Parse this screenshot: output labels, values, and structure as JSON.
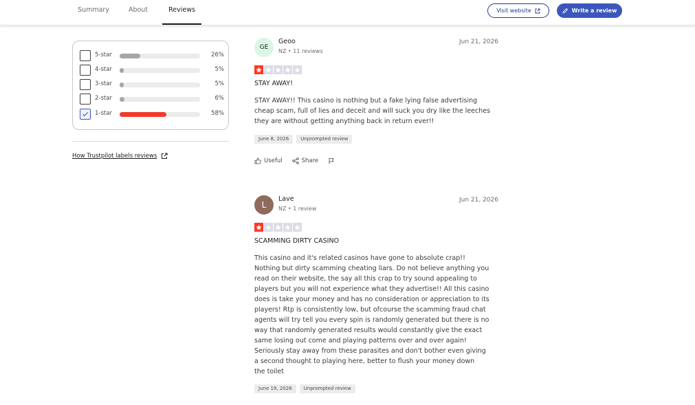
{
  "nav": {
    "tabs": [
      {
        "label": "Summary"
      },
      {
        "label": "About"
      },
      {
        "label": "Reviews",
        "active": true
      }
    ],
    "visit_label": "Visit website",
    "write_label": "Write a review"
  },
  "filters": {
    "rows": [
      {
        "label": "5-star",
        "percent_text": "26%",
        "fill": 0.26,
        "checked": false
      },
      {
        "label": "4-star",
        "percent_text": "5%",
        "fill": 0.05,
        "checked": false
      },
      {
        "label": "3-star",
        "percent_text": "5%",
        "fill": 0.05,
        "checked": false
      },
      {
        "label": "2-star",
        "percent_text": "6%",
        "fill": 0.06,
        "checked": false
      },
      {
        "label": "1-star",
        "percent_text": "58%",
        "fill": 0.58,
        "checked": true
      }
    ],
    "labels_link": "How Trustpilot labels reviews"
  },
  "colors": {
    "accent": "#3c57bc",
    "star_on": "#ff3722",
    "bar_gray": "#a6a6a6",
    "bar_red": "#ef3b2b"
  },
  "reviews": [
    {
      "initials": "GE",
      "name": "Geoo",
      "meta": "NZ • 11 reviews",
      "date": "Jun 21, 2026",
      "rating": 1,
      "title": "STAY AWAY!",
      "body": [
        "STAY AWAY!! This casino is nothing but a fake lying false advertising",
        "cheap scam, full of lies and deceit and will suck you dry like the leeches",
        "they are without getting anything back in return ever!!"
      ],
      "experience_date": "June 8, 2026",
      "tag": "Unprompted review",
      "useful_label": "Useful",
      "share_label": "Share"
    },
    {
      "initials": "L",
      "name": "Lave",
      "meta": "NZ • 1 review",
      "date": "Jun 21, 2026",
      "rating": 1,
      "title": "SCAMMING DIRTY CASINO",
      "body": [
        "This casino and it's related casinos have gone to absolute crap!!",
        "Nothing but dirty scamming cheating liars. Do not believe anything you",
        "read on their website, the say all this crap to try sound appealing to",
        "players but you will not experience what they advertise!! All this casino",
        "does is take your money and has no consideration or appreciation to its",
        "players! Rtp is consistently low, but ofcourse the scamming fraud chat",
        "agents will try tell you every spin is randomly generated but there is no",
        "way that randomly generated results would constantly give the exact",
        "same losing out come and playing patterns over and over again!",
        "Seriously stay away from these parasites and don't bother even giving",
        "a second thought to playing here, better to flush your money down",
        "the toilet"
      ],
      "experience_date": "June 19, 2026",
      "tag": "Unprompted review"
    }
  ]
}
